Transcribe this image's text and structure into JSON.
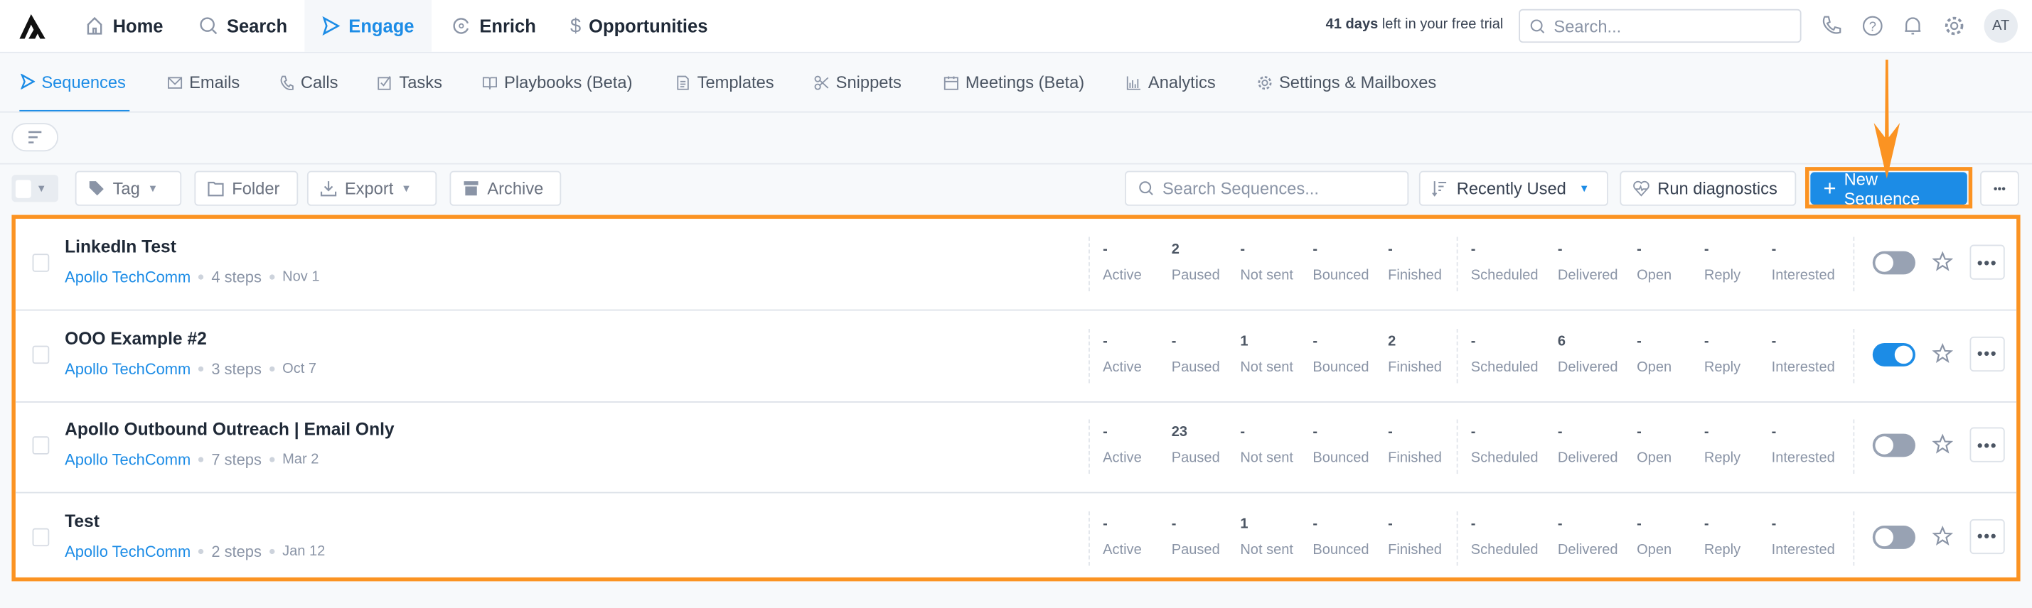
{
  "topnav": {
    "items": [
      {
        "label": "Home",
        "icon": "home-icon"
      },
      {
        "label": "Search",
        "icon": "search-icon"
      },
      {
        "label": "Engage",
        "icon": "send-icon",
        "active": true
      },
      {
        "label": "Enrich",
        "icon": "refresh-icon"
      },
      {
        "label": "Opportunities",
        "icon": "dollar-icon"
      }
    ],
    "trial_bold": "41 days",
    "trial_rest": " left in your free trial",
    "search_placeholder": "Search...",
    "avatar": "AT"
  },
  "subnav": {
    "tabs": [
      "Sequences",
      "Emails",
      "Calls",
      "Tasks",
      "Playbooks (Beta)",
      "Templates",
      "Snippets",
      "Meetings (Beta)",
      "Analytics",
      "Settings & Mailboxes"
    ]
  },
  "toolbar": {
    "tag": "Tag",
    "folder": "Folder",
    "export": "Export",
    "archive": "Archive",
    "search_placeholder": "Search Sequences...",
    "sort": "Recently Used",
    "diagnostics": "Run diagnostics",
    "new_sequence": "New Sequence",
    "more": "•••"
  },
  "stat_labels": [
    "Active",
    "Paused",
    "Not sent",
    "Bounced",
    "Finished",
    "Scheduled",
    "Delivered",
    "Open",
    "Reply",
    "Interested"
  ],
  "colors": {
    "accent": "#1c8ce6",
    "highlight": "#fb9322"
  },
  "sequences": [
    {
      "title": "LinkedIn Test",
      "owner": "Apollo TechComm",
      "steps": "4 steps",
      "date": "Nov 1",
      "stats": [
        "-",
        "2",
        "-",
        "-",
        "-",
        "-",
        "-",
        "-",
        "-",
        "-"
      ],
      "enabled": false
    },
    {
      "title": "OOO Example #2",
      "owner": "Apollo TechComm",
      "steps": "3 steps",
      "date": "Oct 7",
      "stats": [
        "-",
        "-",
        "1",
        "-",
        "2",
        "-",
        "6",
        "-",
        "-",
        "-"
      ],
      "enabled": true
    },
    {
      "title": "Apollo Outbound Outreach | Email Only",
      "owner": "Apollo TechComm",
      "steps": "7 steps",
      "date": "Mar 2",
      "stats": [
        "-",
        "23",
        "-",
        "-",
        "-",
        "-",
        "-",
        "-",
        "-",
        "-"
      ],
      "enabled": false
    },
    {
      "title": "Test",
      "owner": "Apollo TechComm",
      "steps": "2 steps",
      "date": "Jan 12",
      "stats": [
        "-",
        "-",
        "1",
        "-",
        "-",
        "-",
        "-",
        "-",
        "-",
        "-"
      ],
      "enabled": false
    }
  ]
}
